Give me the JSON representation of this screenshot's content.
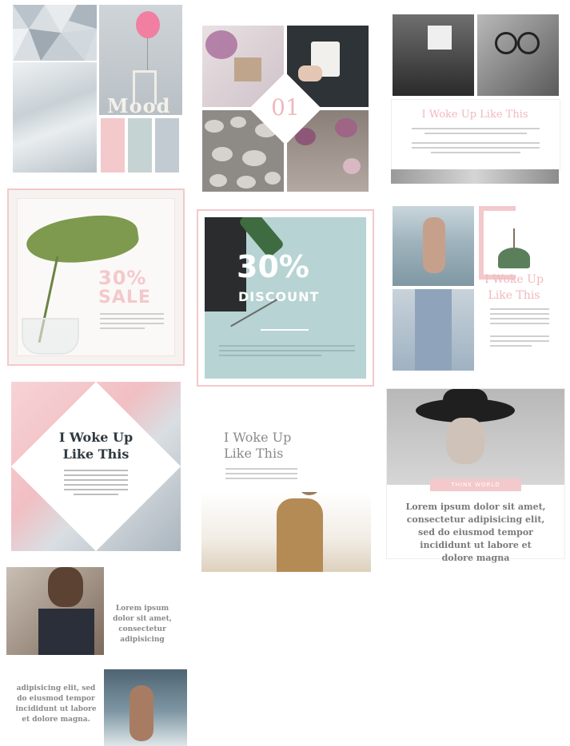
{
  "colors": {
    "pink": "#f3c9cb",
    "pink_text": "#f1b8bc",
    "sage": "#c6d3d3",
    "blue_gray": "#c2cbd2",
    "teal": "#b7d3d3",
    "dark_text": "#2f3a40"
  },
  "tile_mood": {
    "title": "Mood"
  },
  "tile_01": {
    "number": "01"
  },
  "tile_woke_1": {
    "headline": "I Woke Up Like This"
  },
  "tile_sale": {
    "percent": "30%",
    "word": "SALE"
  },
  "tile_discount": {
    "percent": "30%",
    "word": "DISCOUNT"
  },
  "tile_woke_2": {
    "line1": "I Woke Up",
    "line2": "Like This"
  },
  "tile_woke_diamond": {
    "line1": "I Woke Up",
    "line2": "Like This"
  },
  "tile_woke_3": {
    "line1": "I Woke Up",
    "line2": "Like This"
  },
  "tile_hat": {
    "badge": "THINK WORLD",
    "body": "Lorem ipsum dolor sit amet, consectetur adipisicing elit, sed do eiusmod tempor incididunt ut labore et dolore magna"
  },
  "tile_bottom": {
    "text_top": "Lorem ipsum dolor sit amet, consectetur adipisicing",
    "text_bottom": "adipisicing elit, sed do eiusmod tempor incididunt ut labore et dolore magna."
  }
}
